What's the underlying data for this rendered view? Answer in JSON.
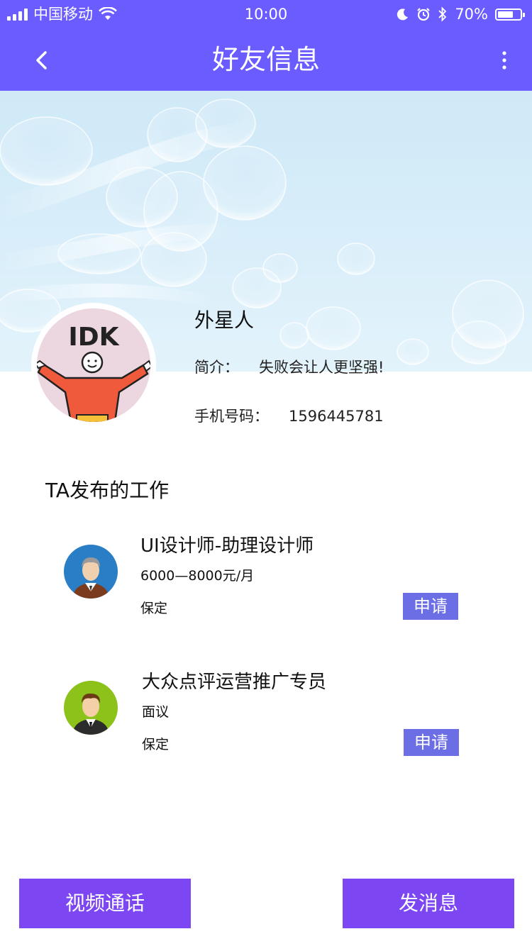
{
  "status_bar": {
    "carrier": "中国移动",
    "time": "10:00",
    "battery_text": "70%",
    "battery_level": 0.7
  },
  "nav": {
    "title": "好友信息",
    "back_icon": "chevron-left-icon",
    "more_icon": "more-vertical-icon"
  },
  "profile": {
    "name": "外星人",
    "bio_label": "简介：",
    "bio_value": "失败会让人更坚强!",
    "phone_label": "手机号码：",
    "phone_value": "1596445781",
    "avatar_text": "IDK"
  },
  "section": {
    "title": "TA发布的工作"
  },
  "jobs": [
    {
      "title": "UI设计师-助理设计师",
      "salary": "6000—8000元/月",
      "location": "保定",
      "apply_label": "申请"
    },
    {
      "title": "大众点评运营推广专员",
      "salary": "面议",
      "location": "保定",
      "apply_label": "申请"
    }
  ],
  "actions": {
    "video_call": "视频通话",
    "send_message": "发消息"
  },
  "colors": {
    "primary": "#6a5cff",
    "apply_button": "#6c6ee6",
    "action_button": "#7c47f2"
  }
}
